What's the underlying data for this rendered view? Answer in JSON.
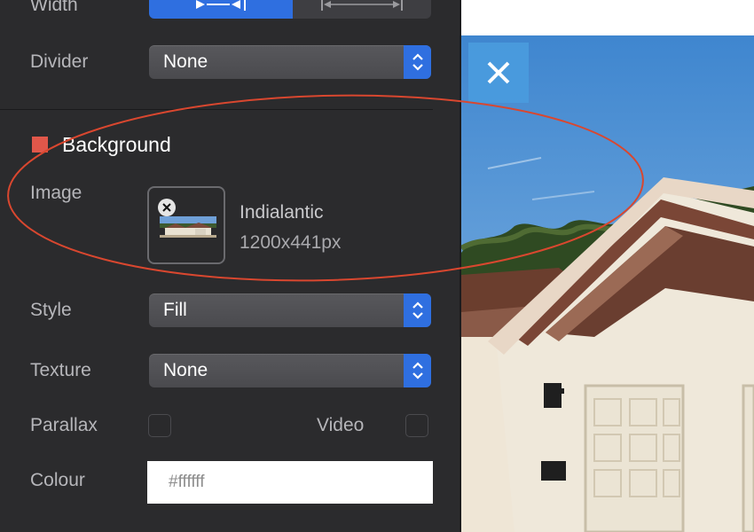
{
  "width_row": {
    "label": "Width"
  },
  "divider_row": {
    "label": "Divider",
    "value": "None"
  },
  "background_section": {
    "title": "Background",
    "accent_color": "#e1574a",
    "image_label": "Image",
    "image_name": "Indialantic",
    "image_size": "1200x441px"
  },
  "style_row": {
    "label": "Style",
    "value": "Fill"
  },
  "texture_row": {
    "label": "Texture",
    "value": "None"
  },
  "parallax_row": {
    "label": "Parallax",
    "checked": false
  },
  "video_row": {
    "label": "Video",
    "checked": false
  },
  "colour_row": {
    "label": "Colour",
    "value": "#ffffff"
  },
  "preview": {
    "close_icon": "close-icon",
    "close_color": "#4a9bdd"
  },
  "annotation": {
    "stroke_color": "#d9472f"
  },
  "theme": {
    "panel_bg": "#2b2b2d",
    "accent_blue": "#2f6fe0"
  }
}
